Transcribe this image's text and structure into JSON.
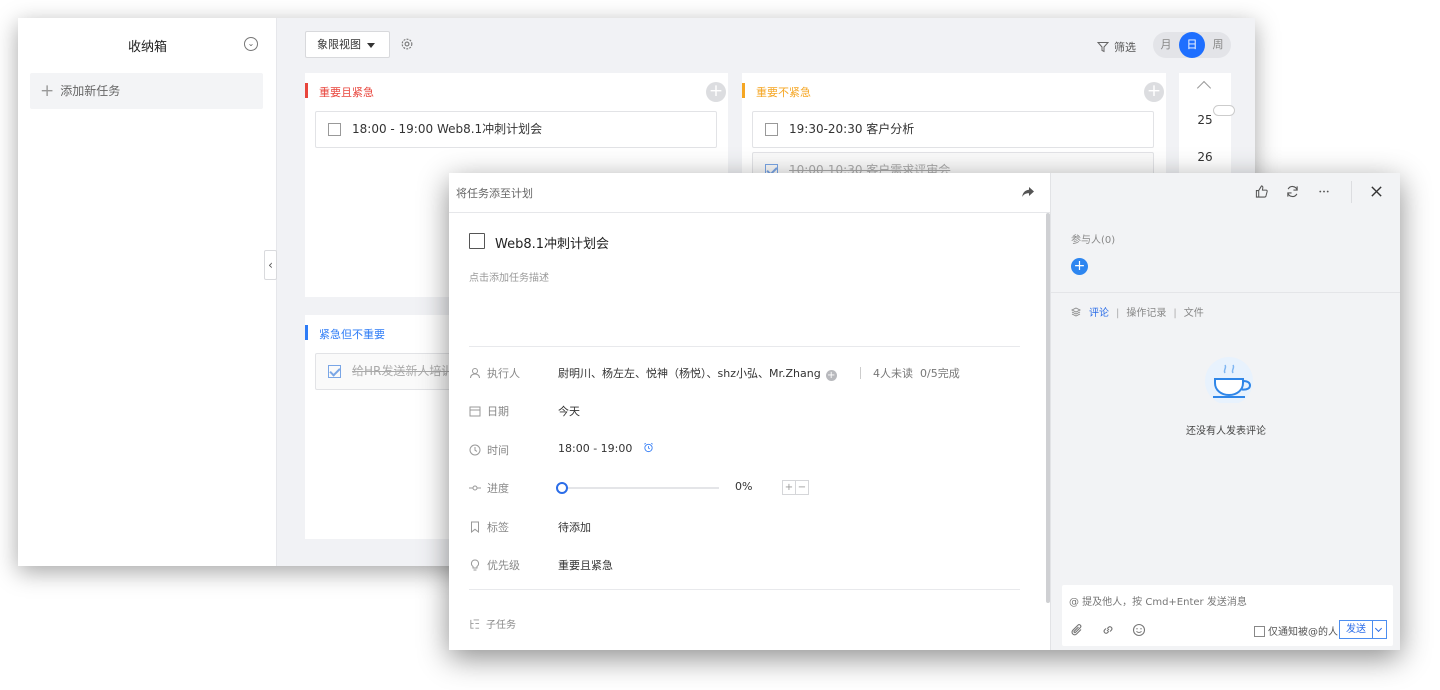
{
  "back_window": {
    "inbox": {
      "title": "收纳箱",
      "add_task": "添加新任务"
    },
    "toolbar": {
      "view_mode": "象限视图",
      "filter": "筛选",
      "period_month": "月",
      "period_day": "日",
      "period_week": "周"
    },
    "quadrants": {
      "important_urgent": {
        "title": "重要且紧急",
        "color": "#e8453c",
        "tasks": [
          "18:00 - 19:00  Web8.1冲刺计划会"
        ]
      },
      "important_not_urgent": {
        "title": "重要不紧急",
        "color": "#f5a623",
        "tasks": [
          "19:30-20:30 客户分析",
          "10:00-10:30 客户需求评审会"
        ]
      },
      "urgent_not_important": {
        "title": "紧急但不重要",
        "color": "#2e7cf6",
        "tasks": [
          "给HR发送新人培训"
        ]
      }
    },
    "calendar_days": [
      "25",
      "26"
    ]
  },
  "task_detail": {
    "header_title": "将任务添至计划",
    "task_title": "Web8.1冲刺计划会",
    "description_placeholder": "点击添加任务描述",
    "fields": {
      "assignee_label": "执行人",
      "assignee_value": "尉明川、杨左左、悦神（杨悦）、shz小弘、Mr.Zhang",
      "unread": "4人未读",
      "completion": "0/5完成",
      "date_label": "日期",
      "date_value": "今天",
      "time_label": "时间",
      "time_value": "18:00 - 19:00",
      "progress_label": "进度",
      "progress_value": "0%",
      "progress_fraction": 0,
      "tag_label": "标签",
      "tag_value": "待添加",
      "priority_label": "优先级",
      "priority_value": "重要且紧急"
    },
    "subtask_label": "子任务"
  },
  "side_panel": {
    "participants": "参与人(0)",
    "tabs": [
      "评论",
      "操作记录",
      "文件"
    ],
    "empty_text": "还没有人发表评论",
    "composer_placeholder": "@ 提及他人，按 Cmd+Enter 发送消息",
    "notify_only": "仅通知被@的人",
    "send": "发送"
  }
}
